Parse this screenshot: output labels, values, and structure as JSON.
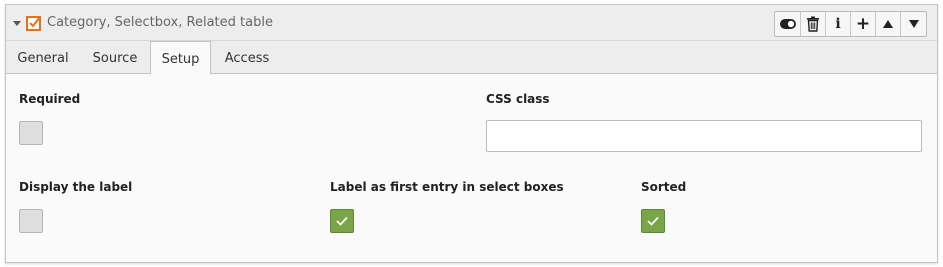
{
  "header": {
    "title": "Category, Selectbox, Related table",
    "icons": {
      "collapse": "chevron-down-icon",
      "record": "checkbox-record-icon",
      "toggle": "toggle-icon",
      "delete": "trash-icon",
      "info": "info-icon",
      "add": "plus-icon",
      "up": "arrow-up-icon",
      "down": "arrow-down-icon"
    },
    "accent_color": "#e8701a"
  },
  "tabs": [
    {
      "label": "General",
      "active": false
    },
    {
      "label": "Source",
      "active": false
    },
    {
      "label": "Setup",
      "active": true
    },
    {
      "label": "Access",
      "active": false
    }
  ],
  "fields": {
    "required": {
      "label": "Required",
      "checked": false
    },
    "css_class": {
      "label": "CSS class",
      "value": ""
    },
    "display_label": {
      "label": "Display the label",
      "checked": false
    },
    "label_first_entry": {
      "label": "Label as first entry in select boxes",
      "checked": true
    },
    "sorted": {
      "label": "Sorted",
      "checked": true
    }
  },
  "colors": {
    "checked": "#79a548",
    "unchecked": "#dedede"
  }
}
